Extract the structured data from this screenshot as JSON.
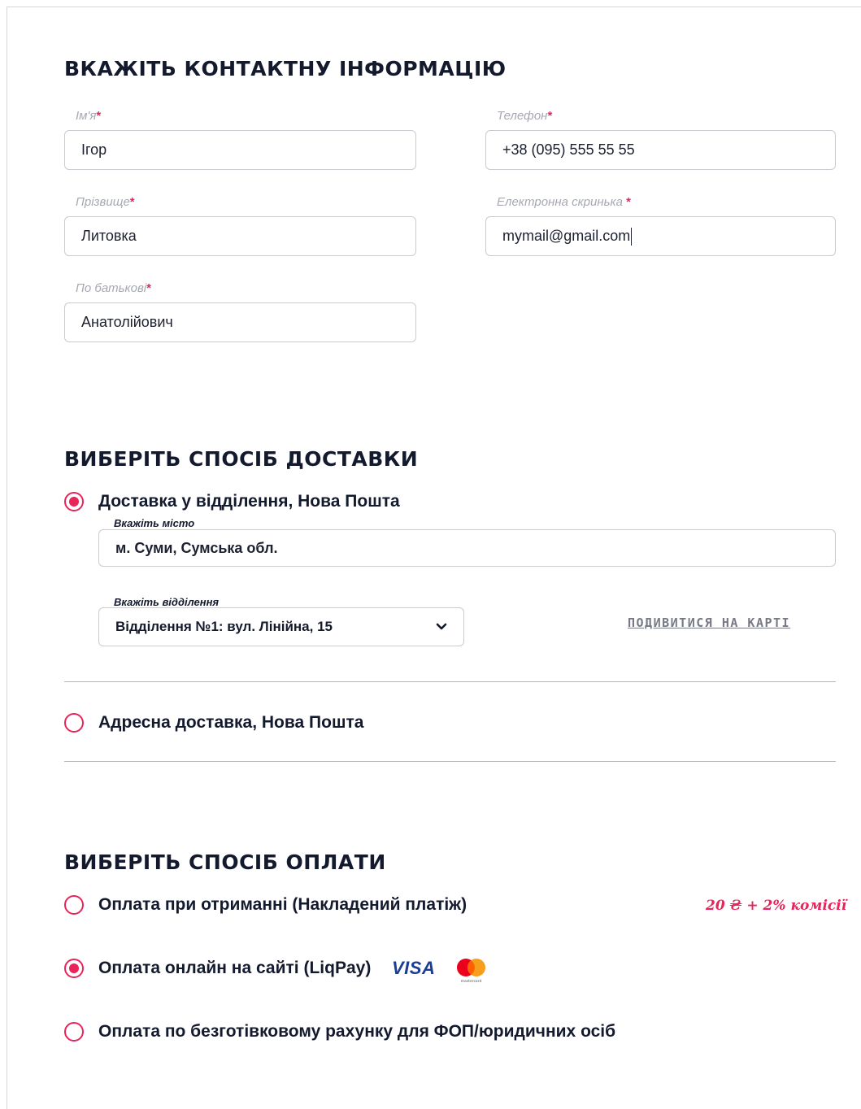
{
  "contact": {
    "title": "Вкажіть контактну інформацію",
    "first_name": {
      "label": "Ім'я",
      "required_mark": "*",
      "value": "Ігор"
    },
    "phone": {
      "label": "Телефон",
      "required_mark": "*",
      "value": "+38 (095) 555 55 55"
    },
    "last_name": {
      "label": "Прізвище",
      "required_mark": "*",
      "value": "Литовка"
    },
    "email": {
      "label": "Електронна скринька ",
      "required_mark": "*",
      "value": "mymail@gmail.com"
    },
    "patronymic": {
      "label": "По батькові",
      "required_mark": "*",
      "value": "Анатолійович"
    }
  },
  "delivery": {
    "title": "Виберіть спосіб доставки",
    "options": [
      {
        "label": "Доставка у відділення, Нова Пошта",
        "selected": true
      },
      {
        "label": "Адресна доставка, Нова Пошта",
        "selected": false
      }
    ],
    "city": {
      "label": "Вкажіть місто",
      "value": "м. Суми, Сумська обл."
    },
    "branch": {
      "label": "Вкажіть відділення",
      "value": "Відділення №1: вул. Лінійна, 15"
    },
    "map_link": "Подивитися на карті"
  },
  "payment": {
    "title": "Виберіть спосіб оплати",
    "options": [
      {
        "label": "Оплата при отриманні (Накладений платіж)",
        "selected": false
      },
      {
        "label": "Оплата онлайн на сайті (LiqPay)",
        "selected": true
      },
      {
        "label": "Оплата по безготівковому рахунку для ФОП/юридичних осіб",
        "selected": false
      }
    ],
    "cod_fee": "20 ₴ + 2% комісії",
    "visa_logo": "VISA",
    "mastercard_logo": "mastercard"
  },
  "colors": {
    "accent": "#e8245a",
    "text": "#141a2e",
    "muted": "#a6a9b3"
  }
}
